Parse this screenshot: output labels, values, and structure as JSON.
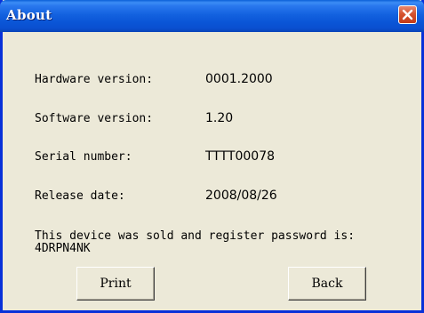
{
  "window": {
    "title": "About",
    "close_icon": "close-x-icon",
    "colors": {
      "titlebar": "#0a55d6",
      "close_button": "#d6532f",
      "background": "#ece9d8"
    }
  },
  "info": {
    "hardware_label": "Hardware version:",
    "hardware_value": "0001.2000",
    "software_label": "Software version:",
    "software_value": "1.20",
    "serial_label": "Serial number:",
    "serial_value": "TTTT00078",
    "release_label": "Release date:",
    "release_value": "2008/08/26"
  },
  "register": {
    "message": "This device was sold and register password is:",
    "password": "4DRPN4NK"
  },
  "buttons": {
    "print_label": "Print",
    "back_label": "Back"
  }
}
